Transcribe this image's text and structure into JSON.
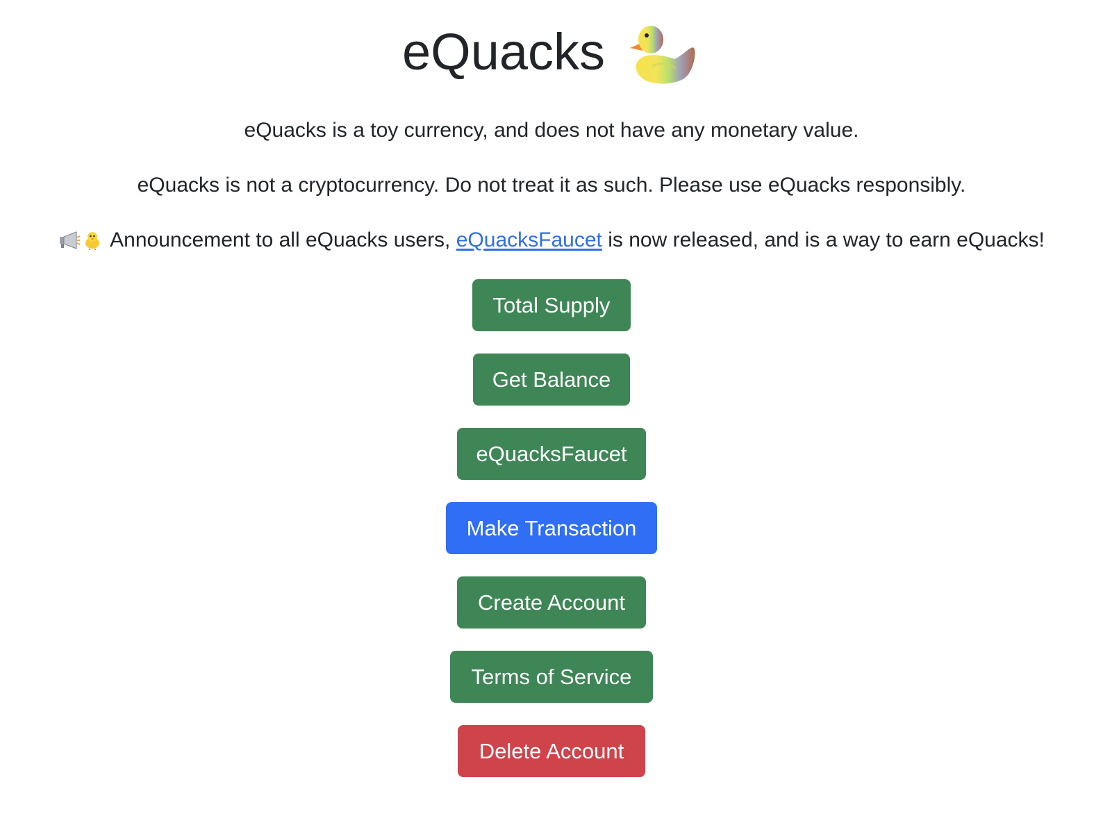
{
  "header": {
    "title": "eQuacks",
    "logo_icon": "rubber-duck-icon"
  },
  "notices": {
    "line1": "eQuacks is a toy currency, and does not have any monetary value.",
    "line2": "eQuacks is not a cryptocurrency. Do not treat it as such. Please use eQuacks responsibly.",
    "announcement": {
      "icons": [
        "megaphone-icon",
        "chick-icon"
      ],
      "text_before": "Announcement to all eQuacks users,",
      "link_text": "eQuacksFaucet",
      "text_after": "is now released, and is a way to earn eQuacks!"
    }
  },
  "buttons": {
    "total_supply": "Total Supply",
    "get_balance": "Get Balance",
    "faucet": "eQuacksFaucet",
    "make_transaction": "Make Transaction",
    "create_account": "Create Account",
    "terms_of_service": "Terms of Service",
    "delete_account": "Delete Account"
  },
  "colors": {
    "text": "#212529",
    "link": "#2f6fe4",
    "success": "#3f8657",
    "primary": "#2f6ef5",
    "danger": "#cf434b"
  }
}
